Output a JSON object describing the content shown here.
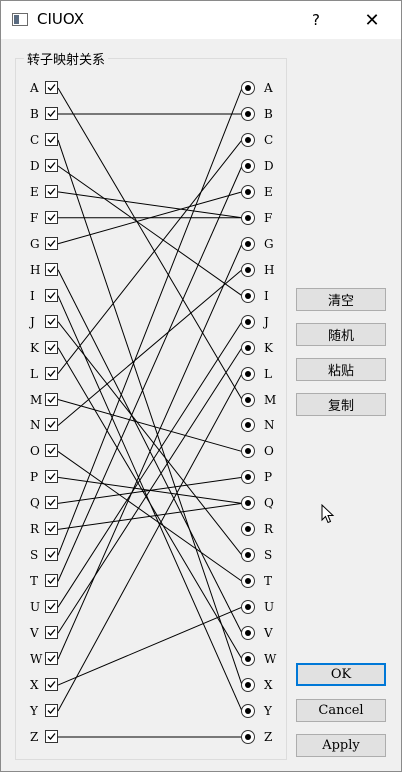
{
  "window": {
    "title": "CIUOX",
    "help_glyph": "?",
    "close_glyph": "✕"
  },
  "group": {
    "title": "转子映射关系"
  },
  "letters": [
    "A",
    "B",
    "C",
    "D",
    "E",
    "F",
    "G",
    "H",
    "I",
    "J",
    "K",
    "L",
    "M",
    "N",
    "O",
    "P",
    "Q",
    "R",
    "S",
    "T",
    "U",
    "V",
    "W",
    "X",
    "Y",
    "Z"
  ],
  "mapping": [
    "M",
    "B",
    "X",
    "I",
    "F",
    "F",
    "E",
    "V",
    "Y",
    "S",
    "W",
    "C",
    "O",
    "H",
    "T",
    "Q",
    "P",
    "Q",
    "A",
    "D",
    "J",
    "K",
    "G",
    "U",
    "L",
    "Z"
  ],
  "buttons": {
    "clear": "清空",
    "random": "随机",
    "paste": "粘贴",
    "copy": "复制",
    "ok": "OK",
    "cancel": "Cancel",
    "apply": "Apply"
  }
}
